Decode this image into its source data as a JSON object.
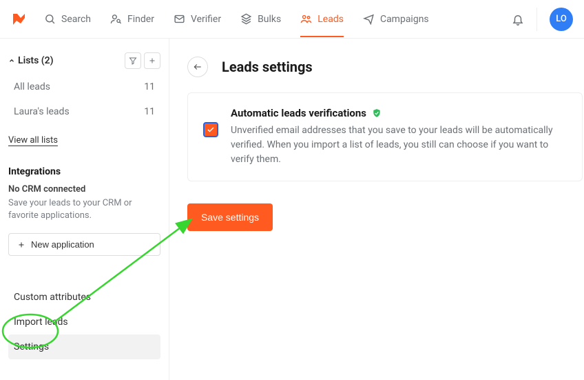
{
  "nav": {
    "items": [
      {
        "label": "Search"
      },
      {
        "label": "Finder"
      },
      {
        "label": "Verifier"
      },
      {
        "label": "Bulks"
      },
      {
        "label": "Leads"
      },
      {
        "label": "Campaigns"
      }
    ],
    "avatar": "LO"
  },
  "sidebar": {
    "lists_label": "Lists (2)",
    "items": [
      {
        "label": "All leads",
        "count": "11"
      },
      {
        "label": "Laura's leads",
        "count": "11"
      }
    ],
    "view_all": "View all lists",
    "integrations_title": "Integrations",
    "no_crm_title": "No CRM connected",
    "no_crm_desc": "Save your leads to your CRM or favorite applications.",
    "new_app": "New application",
    "bottom": {
      "custom_attributes": "Custom attributes",
      "import_leads": "Import leads",
      "settings": "Settings"
    }
  },
  "page": {
    "title": "Leads settings",
    "card_title": "Automatic leads verifications",
    "card_desc": "Unverified email addresses that you save to your leads will be automatically verified. When you import a list of leads, you still can choose if you want to verify them.",
    "save_button": "Save settings"
  }
}
